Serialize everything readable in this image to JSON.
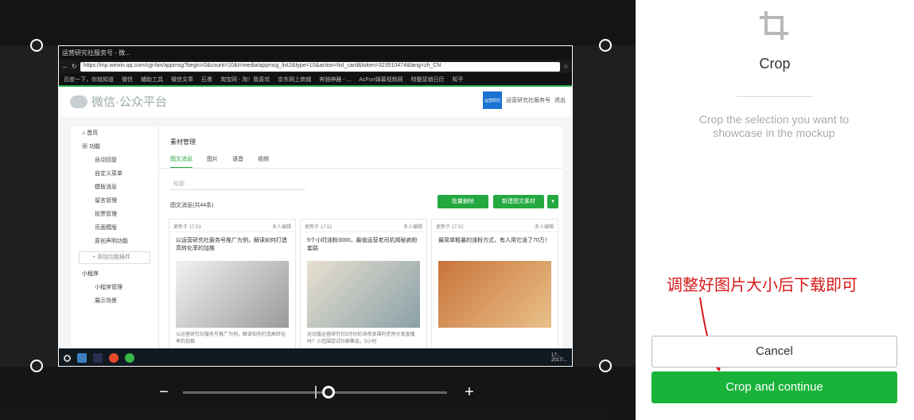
{
  "panel": {
    "icon": "crop-icon",
    "title": "Crop",
    "description": "Crop the selection you want to showcase in the mockup",
    "cancel_label": "Cancel",
    "continue_label": "Crop and continue",
    "accent": "#19b33a"
  },
  "annotation": {
    "text": "调整好图片大小后下载即可",
    "color": "#d71919"
  },
  "zoom": {
    "minus_label": "−",
    "plus_label": "+",
    "level": 0.55
  },
  "screenshot": {
    "tab_title": "运营研究社服务号 - 微...",
    "url": "https://mp.weixin.qq.com/cgi-bin/appmsg?begin=0&count=10&t=media/appmsg_list2&type=10&action=list_card&token=323510474&lang=zh_CN",
    "bookmarks": [
      "百度一下，你就知道",
      "微信",
      "辅助工具",
      "微信文章",
      "石墨",
      "淘宝网 - 淘！我喜欢",
      "京东网上商城",
      "奔驰神器 - ...",
      "AcFun弹幕视频网",
      "特整营销日历",
      "知乎"
    ],
    "logo_text": "微信·公众平台",
    "account_name": "运营研究社服务号",
    "account_avatar": "运营研究",
    "logout": "退出",
    "sidebar": {
      "home": "首页",
      "functions": "功能",
      "items": [
        "自动回复",
        "自定义菜单",
        "模板消息",
        "留言管理",
        "投票管理",
        "页面模版",
        "原创声明功能"
      ],
      "add_plugin": "+ 添加功能插件",
      "mini_program": "小程序",
      "mini_items": [
        "小程序管理",
        "展示场景"
      ]
    },
    "main_title": "素材管理",
    "tabs": [
      "图文消息",
      "图片",
      "语音",
      "视频"
    ],
    "search_placeholder": "标题",
    "batch_delete": "批量删除",
    "new_article": "新建图文素材",
    "count_label": "图文消息(共44条)",
    "cards": [
      {
        "updated": "更新于 17:53",
        "tag": "多人编辑",
        "title": "以运营研究社服务号推广为例，解读如何打造高转化率的加推",
        "desc": "以运营研究社服务号推广为例，解读如何打造高转化率的加推"
      },
      {
        "updated": "更新于 17:52",
        "tag": "多人编辑",
        "title": "5个小时涨粉3000，最值运营老司机揭秘疯粉套路",
        "desc": "运动值运营研究社5月份的深夜发福利老师分享直播吗？小范围尝试社群聚会，5小时"
      },
      {
        "updated": "更新于 17:52",
        "tag": "多人编辑",
        "title": "最简单粗暴的涨粉方式，有人用它涨了70万！",
        "desc": ""
      }
    ],
    "tray_time": "17:..",
    "tray_date": "2017/..."
  }
}
